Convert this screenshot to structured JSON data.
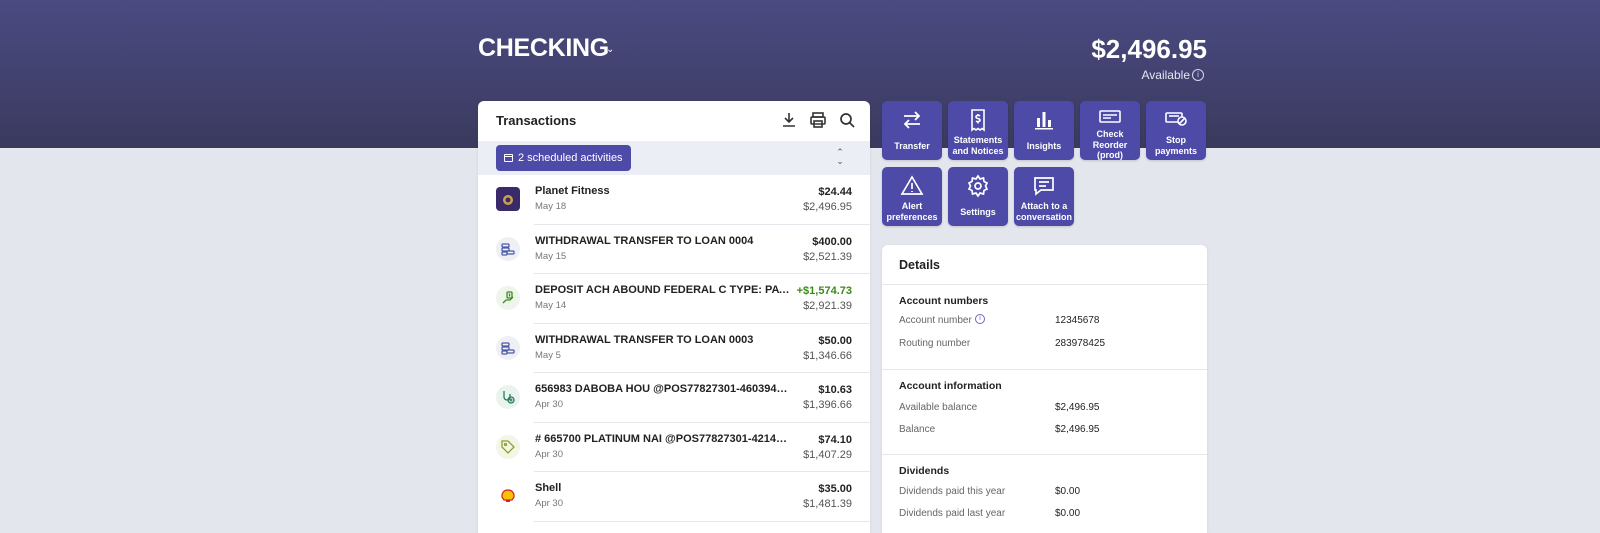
{
  "header": {
    "account_title": "CHECKING",
    "balance": "$2,496.95",
    "available_label": "Available"
  },
  "transactions": {
    "title": "Transactions",
    "scheduled_label": "2 scheduled activities",
    "items": [
      {
        "name": "Planet Fitness",
        "date": "May 18",
        "amount": "$24.44",
        "balance": "$2,496.95",
        "icon": "merchant-avatar"
      },
      {
        "name": "WITHDRAWAL TRANSFER TO LOAN 0004",
        "date": "May 15",
        "amount": "$400.00",
        "balance": "$2,521.39",
        "icon": "coins-icon"
      },
      {
        "name": "DEPOSIT ACH ABOUND FEDERAL C TYPE: PAYROLL...",
        "date": "May 14",
        "amount": "+$1,574.73",
        "balance": "$2,921.39",
        "icon": "hand-money-icon"
      },
      {
        "name": "WITHDRAWAL TRANSFER TO LOAN 0003",
        "date": "May 5",
        "amount": "$50.00",
        "balance": "$1,346.66",
        "icon": "coins-icon"
      },
      {
        "name": "656983 DABOBA HOU @POS77827301-46039478 KY...",
        "date": "Apr 30",
        "amount": "$10.63",
        "balance": "$1,396.66",
        "icon": "health-icon"
      },
      {
        "name": "# 665700 PLATINUM NAI @POS77827301-42148130...",
        "date": "Apr 30",
        "amount": "$74.10",
        "balance": "$1,407.29",
        "icon": "tag-icon"
      },
      {
        "name": "Shell",
        "date": "Apr 30",
        "amount": "$35.00",
        "balance": "$1,481.39",
        "icon": "shell-logo"
      }
    ]
  },
  "actions": [
    {
      "label": "Transfer",
      "icon": "transfer-icon"
    },
    {
      "label": "Statements and Notices",
      "icon": "statement-icon"
    },
    {
      "label": "Insights",
      "icon": "bar-chart-icon"
    },
    {
      "label": "Check Reorder (prod)",
      "icon": "check-icon"
    },
    {
      "label": "Stop payments",
      "icon": "stop-payment-icon"
    },
    {
      "label": "Alert preferences",
      "icon": "alert-icon"
    },
    {
      "label": "Settings",
      "icon": "gear-icon"
    },
    {
      "label": "Attach to a conversation",
      "icon": "chat-icon"
    }
  ],
  "details": {
    "title": "Details",
    "account_numbers": {
      "heading": "Account numbers",
      "account_number_label": "Account number",
      "account_number": "12345678",
      "routing_number_label": "Routing number",
      "routing_number": "283978425"
    },
    "account_information": {
      "heading": "Account information",
      "available_balance_label": "Available balance",
      "available_balance": "$2,496.95",
      "balance_label": "Balance",
      "balance": "$2,496.95"
    },
    "dividends": {
      "heading": "Dividends",
      "this_year_label": "Dividends paid this year",
      "this_year": "$0.00",
      "last_year_label": "Dividends paid last year",
      "last_year": "$0.00"
    }
  },
  "colors": {
    "accent": "#4d4aa8",
    "header_bg": "#3f3e6a",
    "page_bg": "#e4e6ee",
    "positive": "#3a8a1a"
  }
}
